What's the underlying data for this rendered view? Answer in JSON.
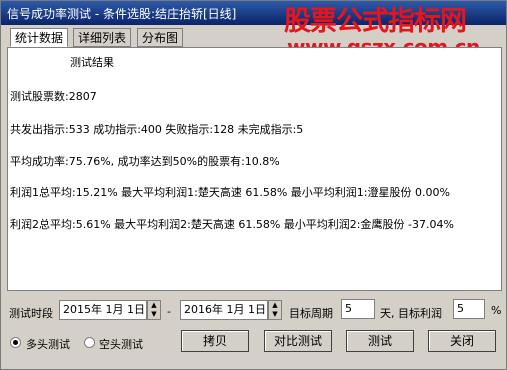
{
  "window": {
    "title": "信号成功率测试 - 条件选股:结庄抬轿[日线]"
  },
  "watermark": {
    "line1": "股票公式指标网",
    "line2": "www.gszx.com.cn",
    "color": "#e8141c"
  },
  "tabs": [
    {
      "label": "统计数据",
      "active": true
    },
    {
      "label": "详细列表",
      "active": false
    },
    {
      "label": "分布图",
      "active": false
    }
  ],
  "results": {
    "heading": "测试结果",
    "lines": [
      "测试股票数:2807",
      "共发出指示:533 成功指示:400 失败指示:128 未完成指示:5",
      "平均成功率:75.76%, 成功率达到50%的股票有:10.8%",
      "利润1总平均:15.21% 最大平均利润1:楚天高速 61.58% 最小平均利润1:澄星股份 0.00%",
      "利润2总平均:5.61% 最大平均利润2:楚天高速 61.58% 最小平均利润2:金鹰股份 -37.04%"
    ]
  },
  "controls": {
    "period_label": "测试时段",
    "start_date": "2015年 1月 1日",
    "dash": "-",
    "end_date": "2016年 1月 1日",
    "target_period_label": "目标周期",
    "target_period_value": "5",
    "profit_label": "天, 目标利润",
    "profit_value": "5",
    "percent": "%"
  },
  "radios": {
    "long_label": "多头测试",
    "short_label": "空头测试",
    "selected": "long"
  },
  "buttons": {
    "copy": "拷贝",
    "compare": "对比测试",
    "test": "测试",
    "close": "关闭"
  }
}
